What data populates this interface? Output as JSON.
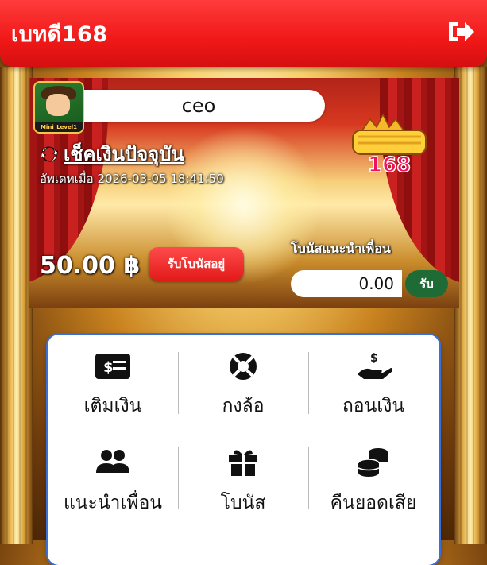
{
  "header": {
    "brand": "เบทดี168"
  },
  "hero": {
    "username": "ceo",
    "avatar_level": "Mini_Level1",
    "check_balance_label": "เช็คเงินปัจจุบัน",
    "updated_label": "อัพเดทเมื่อ 2026-03-05 18:41:50",
    "balance": "50.00 ฿",
    "bonus_button": "รับโบนัสอยู่",
    "referral_label": "โบนัสแนะนำเพื่อน",
    "referral_value": "0.00",
    "referral_button": "รับ",
    "logo_text": "168"
  },
  "menu": [
    {
      "label": "เติมเงิน",
      "icon": "money-bill-icon"
    },
    {
      "label": "กงล้อ",
      "icon": "life-ring-icon"
    },
    {
      "label": "ถอนเงิน",
      "icon": "hand-dollar-icon"
    },
    {
      "label": "แนะนำเพื่อน",
      "icon": "users-icon"
    },
    {
      "label": "โบนัส",
      "icon": "gift-icon"
    },
    {
      "label": "คืนยอดเสีย",
      "icon": "coins-icon"
    }
  ]
}
